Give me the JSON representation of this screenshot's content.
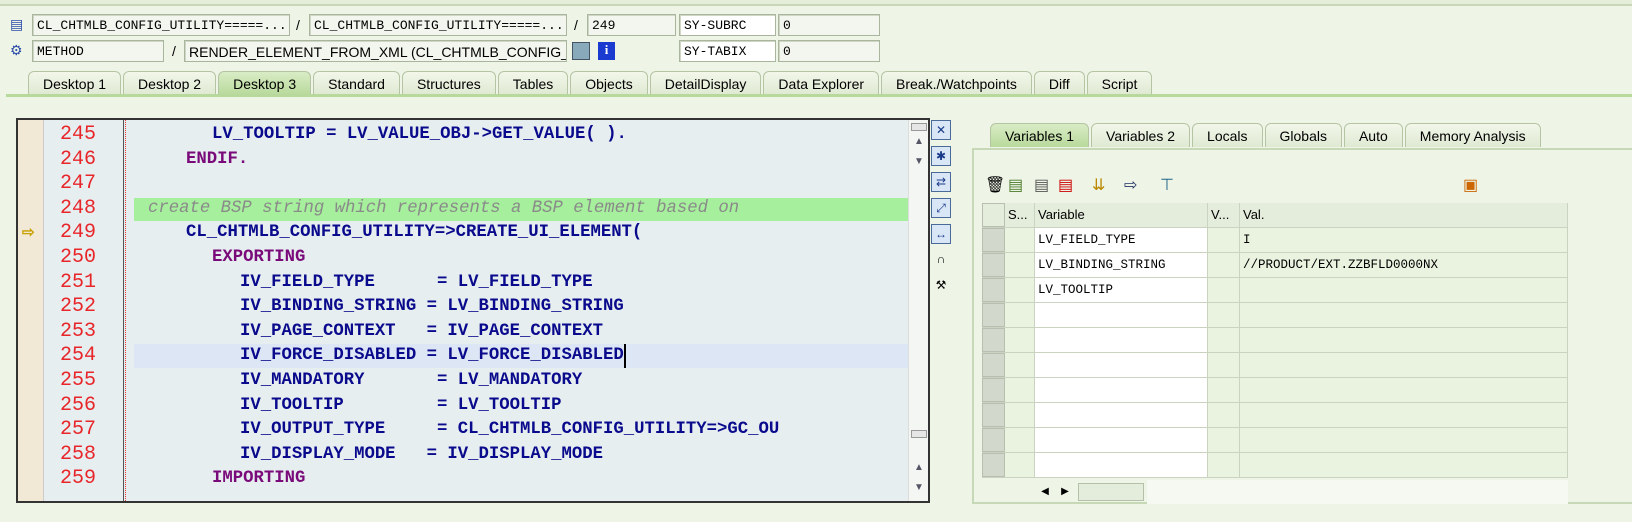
{
  "header": {
    "program": "CL_CHTMLB_CONFIG_UTILITY=====...",
    "include": "CL_CHTMLB_CONFIG_UTILITY=====...",
    "line": "249",
    "sysubrc_label": "SY-SUBRC",
    "sysubrc_value": "0",
    "event_type": "METHOD",
    "event": "RENDER_ELEMENT_FROM_XML (CL_CHTMLB_CONFIG_U...",
    "sytabix_label": "SY-TABIX",
    "sytabix_value": "0",
    "sep": "/"
  },
  "tabs": [
    "Desktop 1",
    "Desktop 2",
    "Desktop 3",
    "Standard",
    "Structures",
    "Tables",
    "Objects",
    "DetailDisplay",
    "Data Explorer",
    "Break./Watchpoints",
    "Diff",
    "Script"
  ],
  "active_tab": "Desktop 3",
  "code": [
    {
      "n": "245",
      "t": "LV_TOOLTIP = LV_VALUE_OBJ->GET_VALUE( )."
    },
    {
      "n": "246",
      "t": "ENDIF."
    },
    {
      "n": "247",
      "t": ""
    },
    {
      "n": "248",
      "t": "create BSP string which represents a BSP element based on"
    },
    {
      "n": "249",
      "t": "CL_CHTMLB_CONFIG_UTILITY=>CREATE_UI_ELEMENT("
    },
    {
      "n": "250",
      "t": "EXPORTING"
    },
    {
      "n": "251",
      "t": "IV_FIELD_TYPE      = LV_FIELD_TYPE"
    },
    {
      "n": "252",
      "t": "IV_BINDING_STRING = LV_BINDING_STRING"
    },
    {
      "n": "253",
      "t": "IV_PAGE_CONTEXT   = IV_PAGE_CONTEXT"
    },
    {
      "n": "254",
      "t": "IV_FORCE_DISABLED = LV_FORCE_DISABLED"
    },
    {
      "n": "255",
      "t": "IV_MANDATORY       = LV_MANDATORY"
    },
    {
      "n": "256",
      "t": "IV_TOOLTIP         = LV_TOOLTIP"
    },
    {
      "n": "257",
      "t": "IV_OUTPUT_TYPE     = CL_CHTMLB_CONFIG_UTILITY=>GC_OU"
    },
    {
      "n": "258",
      "t": "IV_DISPLAY_MODE   = IV_DISPLAY_MODE"
    },
    {
      "n": "259",
      "t": "IMPORTING"
    }
  ],
  "var_tabs": [
    "Variables 1",
    "Variables 2",
    "Locals",
    "Globals",
    "Auto",
    "Memory Analysis"
  ],
  "grid": {
    "headers": [
      "S...",
      "Variable",
      "V...",
      "Val."
    ],
    "rows": [
      {
        "var": "LV_FIELD_TYPE",
        "val": "I"
      },
      {
        "var": "LV_BINDING_STRING",
        "val": "//PRODUCT/EXT.ZZBFLD0000NX"
      },
      {
        "var": "LV_TOOLTIP",
        "val": ""
      }
    ]
  }
}
